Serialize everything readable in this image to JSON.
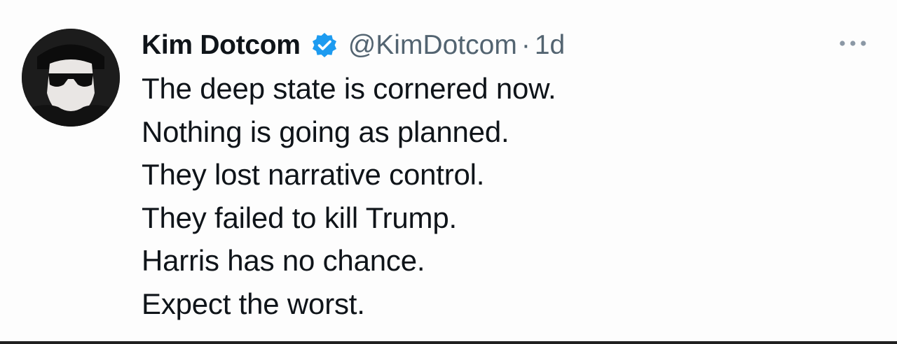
{
  "author": {
    "display_name": "Kim Dotcom",
    "handle": "@KimDotcom",
    "separator": "·",
    "time": "1d",
    "verified_icon": "verified-badge-icon",
    "avatar_icon": "avatar-image"
  },
  "tweet": {
    "lines": [
      "The deep state is cornered now.",
      "Nothing is going as planned.",
      "They lost narrative control.",
      "They failed to kill Trump.",
      "Harris has no chance.",
      "Expect the worst."
    ]
  },
  "menu": {
    "icon": "more-options-icon"
  },
  "colors": {
    "text": "#0f1419",
    "secondary": "#536471",
    "verified": "#1d9bf0"
  }
}
